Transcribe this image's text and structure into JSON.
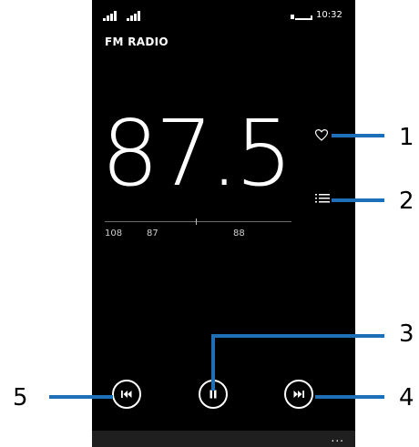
{
  "status": {
    "time": "10:32"
  },
  "app": {
    "title": "FM RADIO"
  },
  "tuner": {
    "frequency": "87.5",
    "scale_labels": [
      "108",
      "87",
      "88"
    ]
  },
  "icons": {
    "favorite": "heart-outline-icon",
    "list": "station-list-icon",
    "previous": "skip-previous-icon",
    "pause": "pause-icon",
    "next": "skip-next-icon"
  },
  "appbar": {
    "more": "..."
  },
  "callouts": [
    "1",
    "2",
    "3",
    "4",
    "5"
  ],
  "colors": {
    "callout": "#1d6fb7",
    "screen_bg": "#000000",
    "appbar_bg": "#1f1f1f"
  }
}
